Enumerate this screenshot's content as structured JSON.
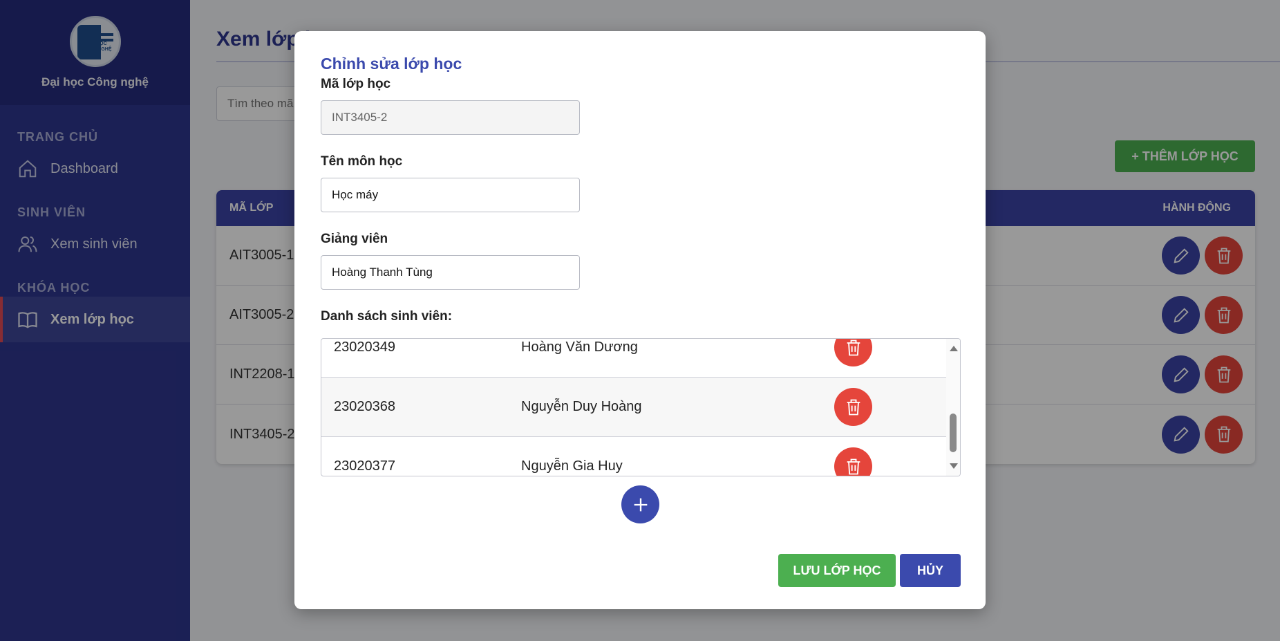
{
  "sidebar": {
    "brand_name": "Đại học Công nghệ",
    "logo_text_1": "ĐẠI HỌC",
    "logo_text_2": "CÔNG NGHỆ",
    "sections": [
      {
        "title": "TRANG CHỦ",
        "item": "Dashboard",
        "icon": "home-icon"
      },
      {
        "title": "SINH VIÊN",
        "item": "Xem sinh viên",
        "icon": "users-icon"
      },
      {
        "title": "KHÓA HỌC",
        "item": "Xem lớp học",
        "icon": "book-icon"
      }
    ],
    "active_item": "Xem lớp học"
  },
  "main": {
    "page_title": "Xem lớp học",
    "search_placeholder": "Tìm theo mã",
    "add_button": "+ THÊM LỚP HỌC",
    "table": {
      "col_code": "MÃ LỚP",
      "col_actions": "HÀNH ĐỘNG",
      "rows": [
        "AIT3005-1",
        "AIT3005-2",
        "INT2208-1",
        "INT3405-2"
      ]
    }
  },
  "modal": {
    "title": "Chỉnh sửa lớp học",
    "code_label": "Mã lớp học",
    "code_value": "INT3405-2",
    "subject_label": "Tên môn học",
    "subject_value": "Học máy",
    "teacher_label": "Giảng viên",
    "teacher_value": "Hoàng Thanh Tùng",
    "students_label": "Danh sách sinh viên:",
    "students": [
      {
        "id": "23020349",
        "name": "Hoàng Văn Dương"
      },
      {
        "id": "23020368",
        "name": "Nguyễn Duy Hoàng"
      },
      {
        "id": "23020377",
        "name": "Nguyễn Gia Huy"
      }
    ],
    "save_button": "LƯU LỚP HỌC",
    "cancel_button": "HỦY"
  },
  "colors": {
    "sidebar": "#2e368e",
    "primary": "#3b43a6",
    "success": "#4caf50",
    "danger": "#e5453b"
  }
}
